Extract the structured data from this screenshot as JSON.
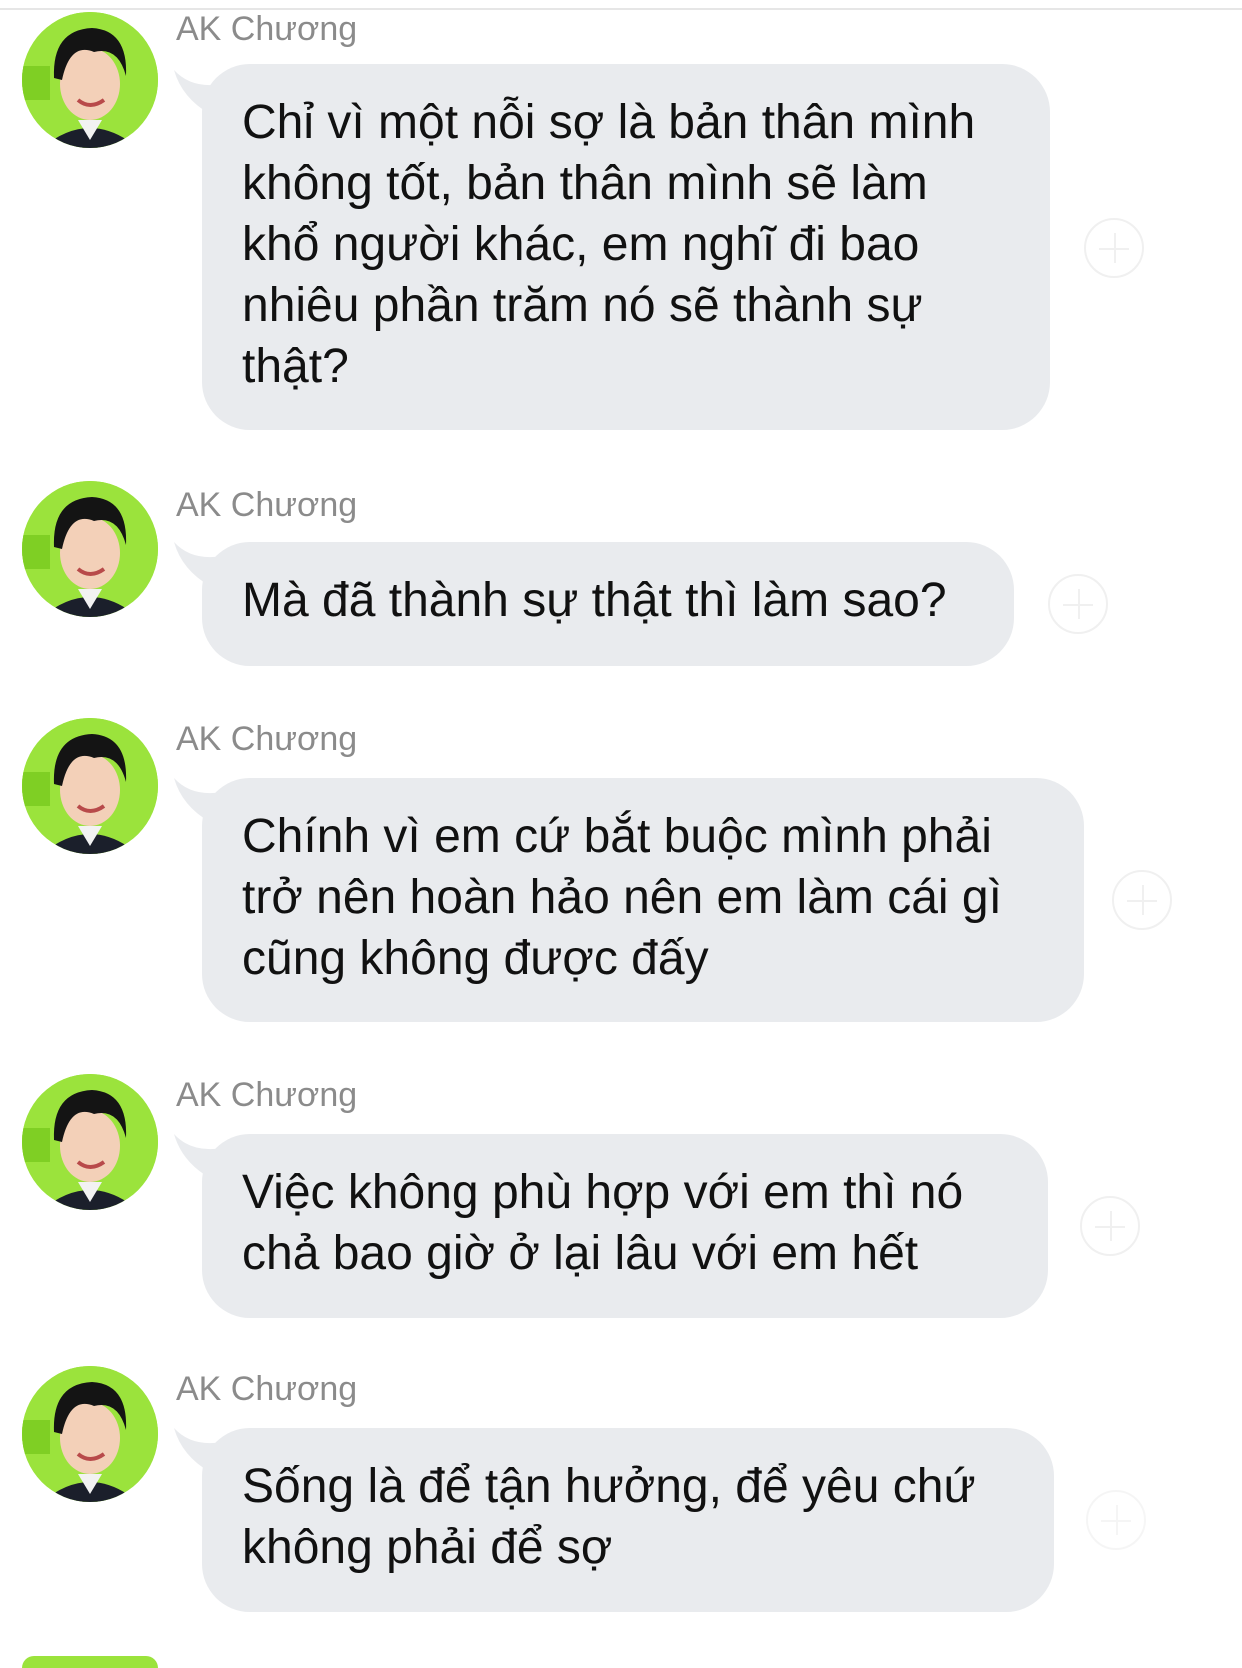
{
  "messages": [
    {
      "sender": "AK Chương",
      "text": "Chỉ vì một nỗi sợ là bản thân mình không tốt, bản thân mình sẽ làm khổ người khác, em nghĩ đi bao nhiêu phần trăm nó sẽ thành sự thật?"
    },
    {
      "sender": "AK Chương",
      "text": "Mà đã thành sự thật thì làm sao?"
    },
    {
      "sender": "AK Chương",
      "text": "Chính vì em cứ bắt buộc mình phải trở nên hoàn hảo nên em làm cái gì cũng không được đấy"
    },
    {
      "sender": "AK Chương",
      "text": "Việc không phù hợp với em thì nó chả bao giờ ở lại lâu với em hết"
    },
    {
      "sender": "AK Chương",
      "text": "Sống là để tận hưởng, để yêu chứ không phải để sợ"
    }
  ],
  "colors": {
    "bubble_bg": "#e9ebee",
    "sender_text": "#8b8b8b",
    "message_text": "#111111",
    "avatar_bg": "#9be33c"
  },
  "icons": {
    "avatar": "profile-photo",
    "reaction": "add-reaction-icon"
  }
}
